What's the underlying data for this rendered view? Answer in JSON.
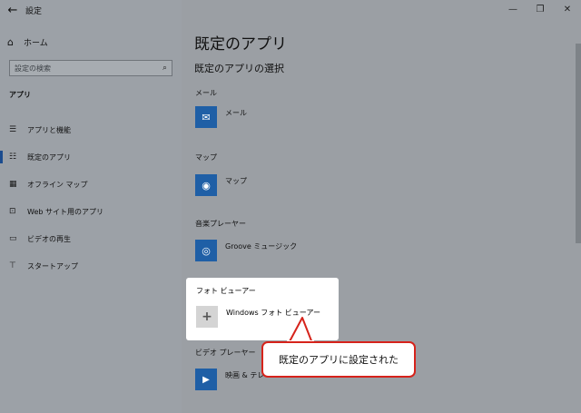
{
  "window": {
    "title": "設定"
  },
  "sidebar": {
    "home": "ホーム",
    "search_placeholder": "設定の検索",
    "section": "アプリ",
    "items": [
      {
        "label": "アプリと機能",
        "icon": "apps-list-icon"
      },
      {
        "label": "既定のアプリ",
        "icon": "default-apps-icon",
        "active": true
      },
      {
        "label": "オフライン マップ",
        "icon": "offline-maps-icon"
      },
      {
        "label": "Web サイト用のアプリ",
        "icon": "websites-icon"
      },
      {
        "label": "ビデオの再生",
        "icon": "video-playback-icon"
      },
      {
        "label": "スタートアップ",
        "icon": "startup-icon"
      }
    ]
  },
  "main": {
    "title": "既定のアプリ",
    "subtitle": "既定のアプリの選択",
    "categories": [
      {
        "label": "メール",
        "app": "メール"
      },
      {
        "label": "マップ",
        "app": "マップ"
      },
      {
        "label": "音楽プレーヤー",
        "app": "Groove ミュージック"
      },
      {
        "label": "フォト ビューアー",
        "app": "Windows フォト ビューアー"
      },
      {
        "label": "ビデオ プレーヤー",
        "app": "映画 & テレ"
      }
    ]
  },
  "callout": {
    "text": "既定のアプリに設定された"
  },
  "colors": {
    "accent": "#1f5fa6",
    "callout_border": "#d6231b"
  }
}
